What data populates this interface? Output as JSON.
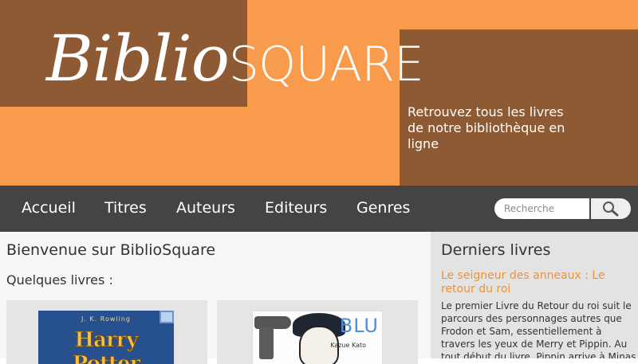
{
  "brand": {
    "logo_italic": "Biblio",
    "logo_caps": "SQUARE",
    "tagline": "Retrouvez tous les livres de notre bibliothèque en ligne"
  },
  "nav": {
    "items": [
      {
        "label": "Accueil"
      },
      {
        "label": "Titres"
      },
      {
        "label": "Auteurs"
      },
      {
        "label": "Editeurs"
      },
      {
        "label": "Genres"
      }
    ],
    "search": {
      "placeholder": "Recherche",
      "icon": "search-icon"
    }
  },
  "main": {
    "title": "Bienvenue sur BiblioSquare",
    "subtitle": "Quelques livres :",
    "books": [
      {
        "cover_author": "J. K. Rowling",
        "cover_title": "Harry Potter"
      },
      {
        "cover_title": "BLU",
        "cover_author": "Kazue Kato"
      }
    ]
  },
  "sidebar": {
    "title": "Derniers livres",
    "latest": {
      "link": "Le seigneur des anneaux : Le retour du roi",
      "description": "Le premier Livre du Retour du roi suit le parcours des personnages autres que Frodon et Sam, essentiellement à travers les yeux de Merry et Pippin. Au tout début du livre, Pippin arrive à Minas Tirith avec"
    }
  },
  "colors": {
    "orange": "#f99b4c",
    "brown": "#8d5a34",
    "navbar": "#444444",
    "link": "#f09135"
  }
}
